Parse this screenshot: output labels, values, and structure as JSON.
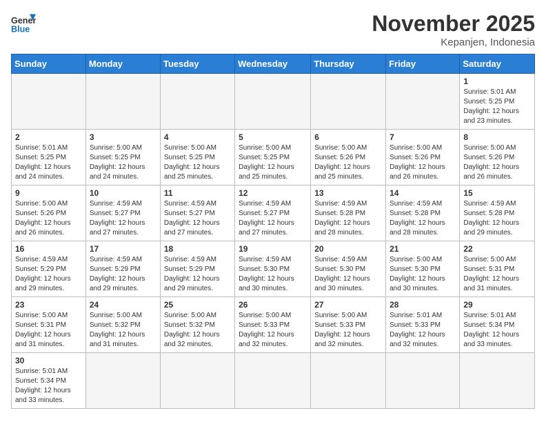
{
  "header": {
    "logo_general": "General",
    "logo_blue": "Blue",
    "month_year": "November 2025",
    "location": "Kepanjen, Indonesia"
  },
  "weekdays": [
    "Sunday",
    "Monday",
    "Tuesday",
    "Wednesday",
    "Thursday",
    "Friday",
    "Saturday"
  ],
  "weeks": [
    [
      {
        "day": "",
        "info": ""
      },
      {
        "day": "",
        "info": ""
      },
      {
        "day": "",
        "info": ""
      },
      {
        "day": "",
        "info": ""
      },
      {
        "day": "",
        "info": ""
      },
      {
        "day": "",
        "info": ""
      },
      {
        "day": "1",
        "info": "Sunrise: 5:01 AM\nSunset: 5:25 PM\nDaylight: 12 hours\nand 23 minutes."
      }
    ],
    [
      {
        "day": "2",
        "info": "Sunrise: 5:01 AM\nSunset: 5:25 PM\nDaylight: 12 hours\nand 24 minutes."
      },
      {
        "day": "3",
        "info": "Sunrise: 5:00 AM\nSunset: 5:25 PM\nDaylight: 12 hours\nand 24 minutes."
      },
      {
        "day": "4",
        "info": "Sunrise: 5:00 AM\nSunset: 5:25 PM\nDaylight: 12 hours\nand 25 minutes."
      },
      {
        "day": "5",
        "info": "Sunrise: 5:00 AM\nSunset: 5:25 PM\nDaylight: 12 hours\nand 25 minutes."
      },
      {
        "day": "6",
        "info": "Sunrise: 5:00 AM\nSunset: 5:26 PM\nDaylight: 12 hours\nand 25 minutes."
      },
      {
        "day": "7",
        "info": "Sunrise: 5:00 AM\nSunset: 5:26 PM\nDaylight: 12 hours\nand 26 minutes."
      },
      {
        "day": "8",
        "info": "Sunrise: 5:00 AM\nSunset: 5:26 PM\nDaylight: 12 hours\nand 26 minutes."
      }
    ],
    [
      {
        "day": "9",
        "info": "Sunrise: 5:00 AM\nSunset: 5:26 PM\nDaylight: 12 hours\nand 26 minutes."
      },
      {
        "day": "10",
        "info": "Sunrise: 4:59 AM\nSunset: 5:27 PM\nDaylight: 12 hours\nand 27 minutes."
      },
      {
        "day": "11",
        "info": "Sunrise: 4:59 AM\nSunset: 5:27 PM\nDaylight: 12 hours\nand 27 minutes."
      },
      {
        "day": "12",
        "info": "Sunrise: 4:59 AM\nSunset: 5:27 PM\nDaylight: 12 hours\nand 27 minutes."
      },
      {
        "day": "13",
        "info": "Sunrise: 4:59 AM\nSunset: 5:28 PM\nDaylight: 12 hours\nand 28 minutes."
      },
      {
        "day": "14",
        "info": "Sunrise: 4:59 AM\nSunset: 5:28 PM\nDaylight: 12 hours\nand 28 minutes."
      },
      {
        "day": "15",
        "info": "Sunrise: 4:59 AM\nSunset: 5:28 PM\nDaylight: 12 hours\nand 29 minutes."
      }
    ],
    [
      {
        "day": "16",
        "info": "Sunrise: 4:59 AM\nSunset: 5:29 PM\nDaylight: 12 hours\nand 29 minutes."
      },
      {
        "day": "17",
        "info": "Sunrise: 4:59 AM\nSunset: 5:29 PM\nDaylight: 12 hours\nand 29 minutes."
      },
      {
        "day": "18",
        "info": "Sunrise: 4:59 AM\nSunset: 5:29 PM\nDaylight: 12 hours\nand 29 minutes."
      },
      {
        "day": "19",
        "info": "Sunrise: 4:59 AM\nSunset: 5:30 PM\nDaylight: 12 hours\nand 30 minutes."
      },
      {
        "day": "20",
        "info": "Sunrise: 4:59 AM\nSunset: 5:30 PM\nDaylight: 12 hours\nand 30 minutes."
      },
      {
        "day": "21",
        "info": "Sunrise: 5:00 AM\nSunset: 5:30 PM\nDaylight: 12 hours\nand 30 minutes."
      },
      {
        "day": "22",
        "info": "Sunrise: 5:00 AM\nSunset: 5:31 PM\nDaylight: 12 hours\nand 31 minutes."
      }
    ],
    [
      {
        "day": "23",
        "info": "Sunrise: 5:00 AM\nSunset: 5:31 PM\nDaylight: 12 hours\nand 31 minutes."
      },
      {
        "day": "24",
        "info": "Sunrise: 5:00 AM\nSunset: 5:32 PM\nDaylight: 12 hours\nand 31 minutes."
      },
      {
        "day": "25",
        "info": "Sunrise: 5:00 AM\nSunset: 5:32 PM\nDaylight: 12 hours\nand 32 minutes."
      },
      {
        "day": "26",
        "info": "Sunrise: 5:00 AM\nSunset: 5:33 PM\nDaylight: 12 hours\nand 32 minutes."
      },
      {
        "day": "27",
        "info": "Sunrise: 5:00 AM\nSunset: 5:33 PM\nDaylight: 12 hours\nand 32 minutes."
      },
      {
        "day": "28",
        "info": "Sunrise: 5:01 AM\nSunset: 5:33 PM\nDaylight: 12 hours\nand 32 minutes."
      },
      {
        "day": "29",
        "info": "Sunrise: 5:01 AM\nSunset: 5:34 PM\nDaylight: 12 hours\nand 33 minutes."
      }
    ],
    [
      {
        "day": "30",
        "info": "Sunrise: 5:01 AM\nSunset: 5:34 PM\nDaylight: 12 hours\nand 33 minutes."
      },
      {
        "day": "",
        "info": ""
      },
      {
        "day": "",
        "info": ""
      },
      {
        "day": "",
        "info": ""
      },
      {
        "day": "",
        "info": ""
      },
      {
        "day": "",
        "info": ""
      },
      {
        "day": "",
        "info": ""
      }
    ]
  ]
}
